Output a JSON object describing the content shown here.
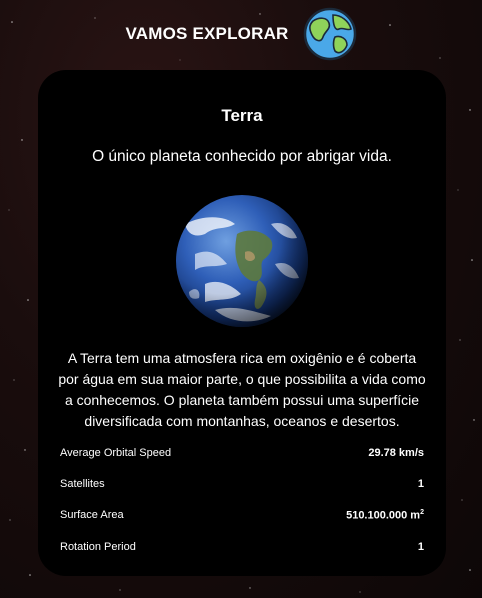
{
  "header": {
    "title": "VAMOS EXPLORAR",
    "icon": "earth-globe-icon"
  },
  "planet": {
    "name": "Terra",
    "tagline": "O único planeta conhecido por abrigar vida.",
    "description": "A Terra tem uma atmosfera rica em oxigênio e é coberta por água em sua maior parte, o que possibilita a vida como a conhecemos. O planeta também possui uma superfície diversificada com montanhas, oceanos e desertos."
  },
  "stats": [
    {
      "label": "Average Orbital Speed",
      "value": "29.78 km/s"
    },
    {
      "label": "Satellites",
      "value": "1"
    },
    {
      "label": "Surface Area",
      "value": "510.100.000 m",
      "unit_sup": "2"
    },
    {
      "label": "Rotation Period",
      "value": "1"
    }
  ],
  "colors": {
    "card_background": "#000000",
    "page_background": "#1a0d0d",
    "text": "#ffffff"
  }
}
